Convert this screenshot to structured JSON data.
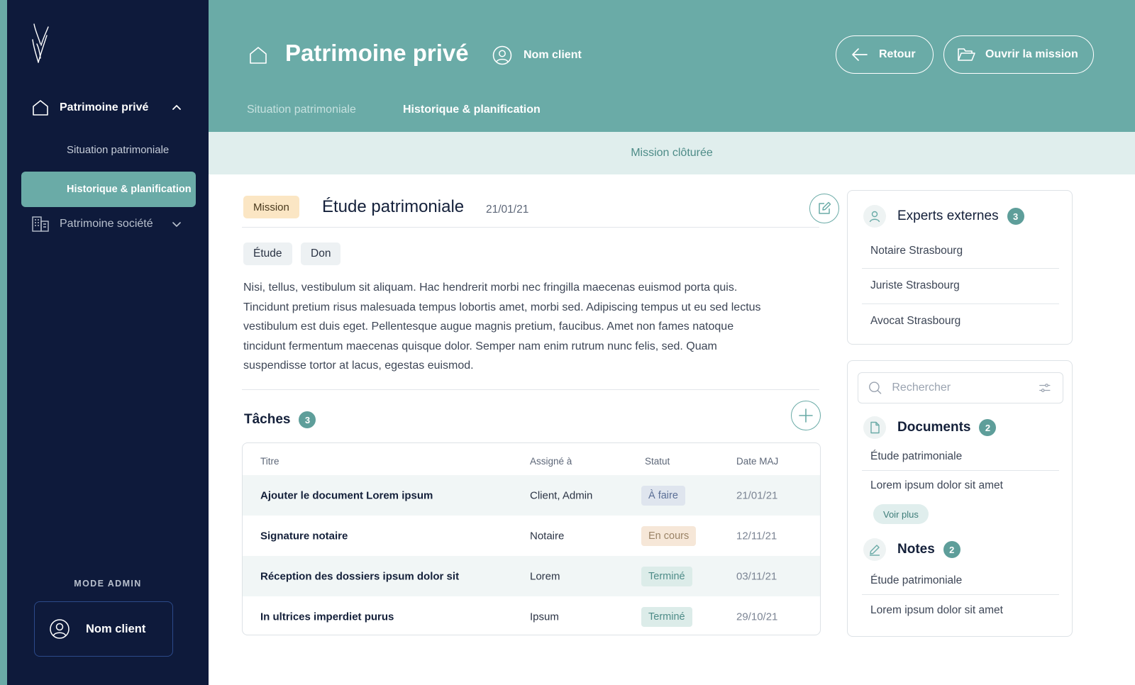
{
  "sidebar": {
    "nav_parent_label": "Patrimoine privé",
    "sub_items": [
      "Situation patrimoniale",
      "Historique & planification"
    ],
    "nav_parent2_label": "Patrimoine société",
    "mode_label": "MODE ADMIN",
    "user_label": "Nom client"
  },
  "header": {
    "title": "Patrimoine privé",
    "client_label": "Nom client",
    "back_label": "Retour",
    "open_label": "Ouvrir la mission",
    "tabs": [
      "Situation patrimoniale",
      "Historique & planification"
    ]
  },
  "banner": "Mission clôturée",
  "mission": {
    "badge": "Mission",
    "title": "Étude patrimoniale",
    "date": "21/01/21",
    "tags": [
      "Étude",
      "Don"
    ],
    "description": "Nisi, tellus, vestibulum sit aliquam. Hac hendrerit morbi nec fringilla maecenas euismod porta quis. Tincidunt pretium risus malesuada tempus lobortis amet, morbi sed. Adipiscing tempus ut eu sed lectus vestibulum est duis eget. Pellentesque augue magnis pretium, faucibus. Amet non fames natoque tincidunt fermentum maecenas quisque dolor. Semper nam enim rutrum nunc felis, sed. Quam suspendisse tortor at lacus, egestas euismod."
  },
  "tasks": {
    "title": "Tâches",
    "count": "3",
    "columns": [
      "Titre",
      "Assigné à",
      "Statut",
      "Date MAJ"
    ],
    "rows": [
      {
        "title": "Ajouter le document Lorem ipsum",
        "assignee": "Client, Admin",
        "status": "À faire",
        "date": "21/01/21"
      },
      {
        "title": "Signature notaire",
        "assignee": "Notaire",
        "status": "En cours",
        "date": "12/11/21"
      },
      {
        "title": "Réception des dossiers ipsum dolor sit",
        "assignee": "Lorem",
        "status": "Terminé",
        "date": "03/11/21"
      },
      {
        "title": "In ultrices imperdiet purus",
        "assignee": "Ipsum",
        "status": "Terminé",
        "date": "29/10/21"
      }
    ]
  },
  "experts": {
    "title": "Experts externes",
    "count": "3",
    "items": [
      "Notaire Strasbourg",
      "Juriste Strasbourg",
      "Avocat Strasbourg"
    ]
  },
  "search": {
    "placeholder": "Rechercher"
  },
  "documents": {
    "title": "Documents",
    "count": "2",
    "items": [
      "Étude patrimoniale",
      "Lorem ipsum dolor sit amet"
    ],
    "more_label": "Voir plus"
  },
  "notes": {
    "title": "Notes",
    "count": "2",
    "items": [
      "Étude patrimoniale",
      "Lorem ipsum dolor sit amet"
    ]
  },
  "colors": {
    "teal": "#6aaba7",
    "navy": "#0e1a3b",
    "status_todo_bg": "#dfe5ee",
    "status_progress_bg": "#f6e7d8",
    "status_done_bg": "#dcece9"
  }
}
